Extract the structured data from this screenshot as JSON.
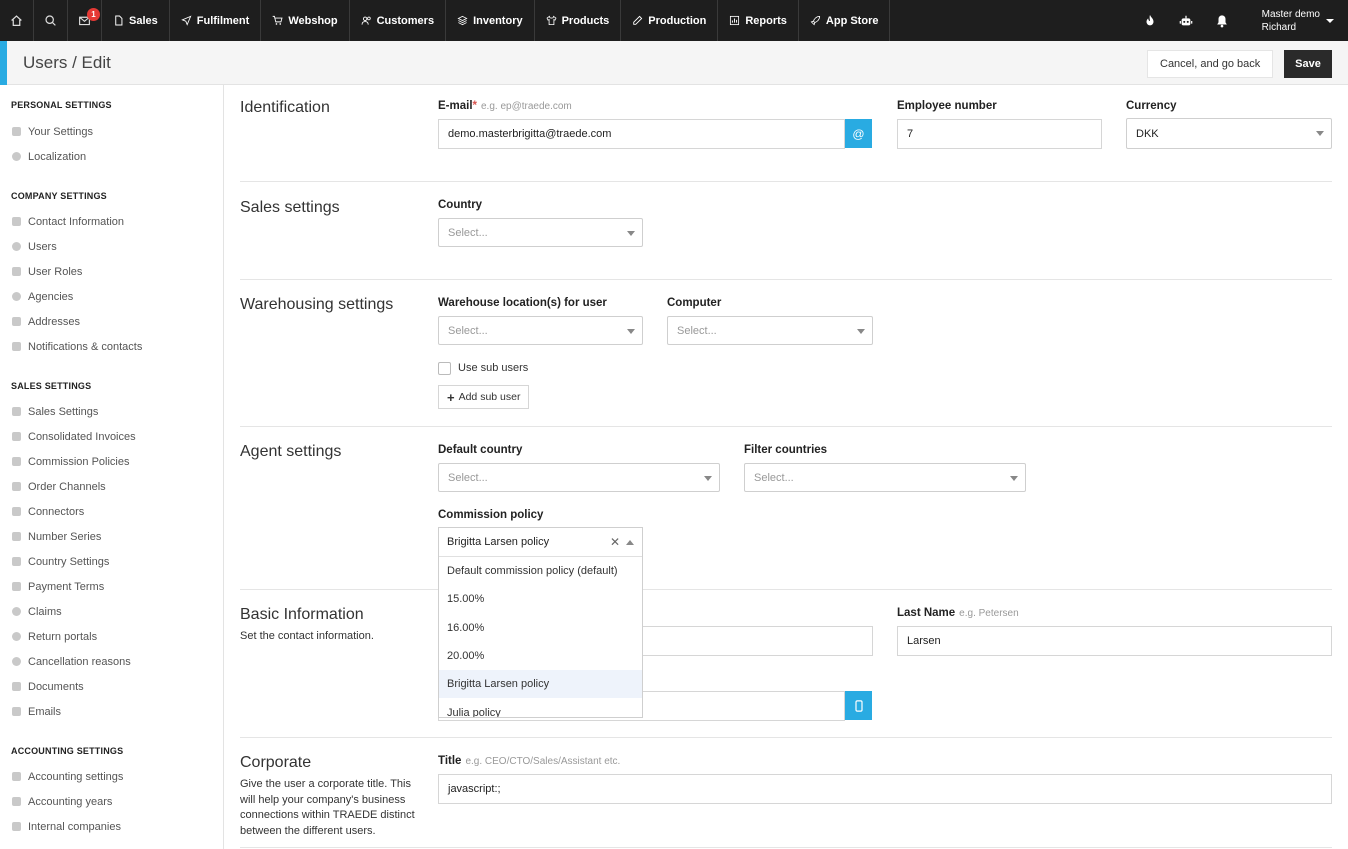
{
  "topbar": {
    "notification_count": "1",
    "nav": [
      "Sales",
      "Fulfilment",
      "Webshop",
      "Customers",
      "Inventory",
      "Products",
      "Production",
      "Reports",
      "App Store"
    ],
    "user_line1": "Master demo",
    "user_line2": "Richard"
  },
  "header": {
    "title": "Users / Edit",
    "cancel_label": "Cancel, and go back",
    "save_label": "Save"
  },
  "sidebar": {
    "personal_title": "PERSONAL SETTINGS",
    "personal": [
      "Your Settings",
      "Localization"
    ],
    "company_title": "COMPANY SETTINGS",
    "company": [
      "Contact Information",
      "Users",
      "User Roles",
      "Agencies",
      "Addresses",
      "Notifications & contacts"
    ],
    "sales_title": "SALES SETTINGS",
    "sales": [
      "Sales Settings",
      "Consolidated Invoices",
      "Commission Policies",
      "Order Channels",
      "Connectors",
      "Number Series",
      "Country Settings",
      "Payment Terms",
      "Claims",
      "Return portals",
      "Cancellation reasons",
      "Documents",
      "Emails"
    ],
    "accounting_title": "ACCOUNTING SETTINGS",
    "accounting": [
      "Accounting settings",
      "Accounting years",
      "Internal companies"
    ]
  },
  "identification": {
    "title": "Identification",
    "email_label": "E-mail",
    "email_required": "*",
    "email_hint": "e.g. ep@traede.com",
    "email_value": "demo.masterbrigitta@traede.com",
    "email_addon": "@",
    "employee_label": "Employee number",
    "employee_value": "7",
    "currency_label": "Currency",
    "currency_value": "DKK"
  },
  "sales_settings": {
    "title": "Sales settings",
    "country_label": "Country",
    "country_placeholder": "Select..."
  },
  "warehousing": {
    "title": "Warehousing settings",
    "location_label": "Warehouse location(s) for user",
    "location_placeholder": "Select...",
    "computer_label": "Computer",
    "computer_placeholder": "Select...",
    "sub_users_label": "Use sub users",
    "add_sub_user_label": "Add sub user"
  },
  "agent": {
    "title": "Agent settings",
    "default_country_label": "Default country",
    "default_country_placeholder": "Select...",
    "filter_countries_label": "Filter countries",
    "filter_countries_placeholder": "Select...",
    "commission_label": "Commission policy",
    "commission_value": "Brigitta Larsen policy",
    "commission_options": [
      "Default commission policy (default)",
      "15.00%",
      "16.00%",
      "20.00%",
      "Brigitta Larsen policy",
      "Julia policy"
    ]
  },
  "basic": {
    "title": "Basic Information",
    "desc": "Set the contact information.",
    "lastname_label": "Last Name",
    "lastname_hint": "e.g. Petersen",
    "lastname_value": "Larsen"
  },
  "corporate": {
    "title": "Corporate",
    "desc": "Give the user a corporate title. This will help your company's business connections within TRAEDE distinct between the different users.",
    "title_label": "Title",
    "title_hint": "e.g. CEO/CTO/Sales/Assistant etc.",
    "title_value": "javascript:;"
  }
}
